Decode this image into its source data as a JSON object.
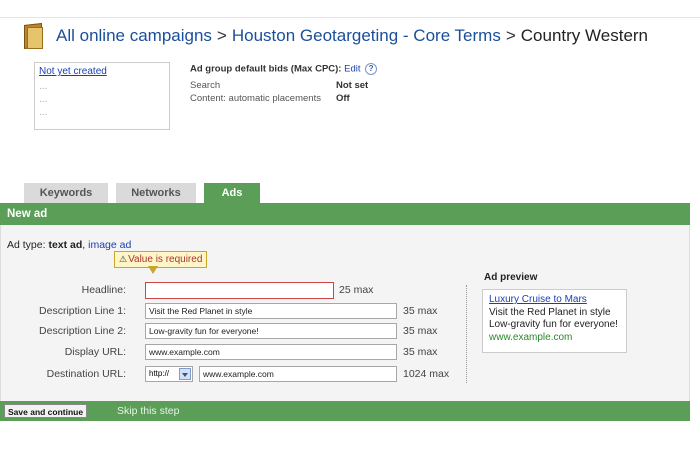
{
  "breadcrumb": {
    "campaigns": "All online campaigns",
    "campaign": "Houston Geotargeting - Core Terms",
    "adgroup": "Country Western",
    "separator": ">"
  },
  "status_box": {
    "link": "Not yet created",
    "dots": [
      "...",
      "...",
      "..."
    ]
  },
  "bids": {
    "title": "Ad group default bids (Max CPC):",
    "edit": "Edit",
    "help": "?",
    "rows": [
      {
        "label": "Search",
        "value": "Not set"
      },
      {
        "label": "Content: automatic placements",
        "value": "Off"
      }
    ]
  },
  "tabs": [
    {
      "label": "Keywords",
      "active": false
    },
    {
      "label": "Networks",
      "active": false
    },
    {
      "label": "Ads",
      "active": true
    }
  ],
  "new_ad": {
    "title": "New ad"
  },
  "ad_type": {
    "prefix": "Ad type:",
    "current": "text ad",
    "separator": ",",
    "other": "image ad"
  },
  "tooltip": {
    "icon": "⚠",
    "text": "Value is required"
  },
  "form": {
    "headline": {
      "label": "Headline:",
      "value": "",
      "max": "25 max"
    },
    "desc1": {
      "label": "Description Line 1:",
      "value": "Visit the Red Planet in style",
      "max": "35 max"
    },
    "desc2": {
      "label": "Description Line 2:",
      "value": "Low-gravity fun for everyone!",
      "max": "35 max"
    },
    "display_url": {
      "label": "Display URL:",
      "value": "www.example.com",
      "max": "35 max"
    },
    "destination_url": {
      "label": "Destination URL:",
      "protocol": "http://",
      "value": "www.example.com",
      "max": "1024 max"
    }
  },
  "preview": {
    "title": "Ad preview",
    "headline": "Luxury Cruise to Mars",
    "line1": "Visit the Red Planet in style",
    "line2": "Low-gravity fun for everyone!",
    "url": "www.example.com"
  },
  "footer": {
    "save": "Save and continue",
    "skip": "Skip this step"
  },
  "colors": {
    "accent_green": "#5a9e57",
    "link_blue": "#1a3fb0",
    "error_red": "#c44"
  }
}
